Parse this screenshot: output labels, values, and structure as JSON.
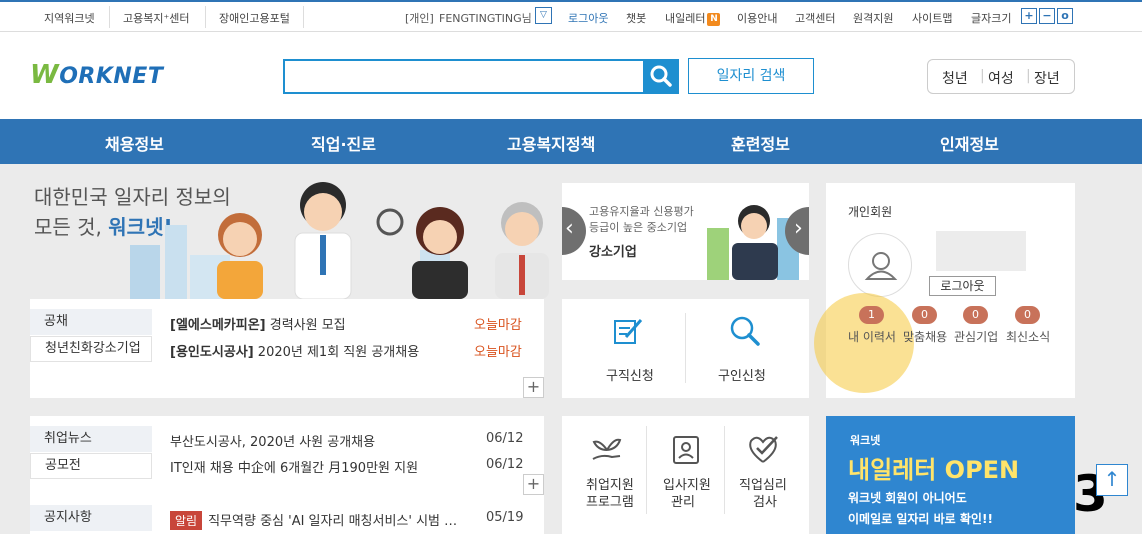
{
  "topbar": {
    "links": [
      "지역워크넷",
      "고용복지⁺센터",
      "장애인고용포털"
    ],
    "user_type": "[개인]",
    "user_name": "FENGTINGTING님",
    "dropdown": "▽",
    "logout": "로그아웃",
    "chatbot": "챗봇",
    "newsletter": "내일레터",
    "newsletter_badge": "N",
    "guide": "이용안내",
    "support": "고객센터",
    "remote": "원격지원",
    "sitemap": "사이트맵",
    "fontsize": "글자크기",
    "font_plus": "+",
    "font_minus": "−",
    "font_reset": "o"
  },
  "header": {
    "logo_w": "W",
    "logo_rest": "ORKNET",
    "search_placeholder": "",
    "job_search": "일자리 검색",
    "targets": [
      "청년",
      "여성",
      "장년"
    ]
  },
  "nav": [
    "채용정보",
    "직업·진로",
    "고용복지정책",
    "훈련정보",
    "인재정보"
  ],
  "hero": {
    "line1": "대한민국 일자리 정보의",
    "line2a": "모든 것, ",
    "line2b": "워크넷!"
  },
  "recruit": {
    "tabs": [
      "공채",
      "청년친화강소기업"
    ],
    "rows": [
      {
        "company": "[엘에스메카피온]",
        "title": "경력사원 모집",
        "due": "오늘마감"
      },
      {
        "company": "[용인도시공사]",
        "title": "2020년 제1회 직원 공개채용",
        "due": "오늘마감"
      }
    ],
    "more": "+"
  },
  "banner": {
    "line1": "고용유지율과 신용평가",
    "line2": "등급이 높은 중소기업",
    "line3": "강소기업",
    "prev": "‹",
    "next": "›"
  },
  "services": {
    "apply_job": "구직신청",
    "apply_hire": "구인신청"
  },
  "member": {
    "title": "개인회원",
    "logout": "로그아웃",
    "items": [
      {
        "label": "내 이력서",
        "count": "1"
      },
      {
        "label": "맞춤채용",
        "count": "0"
      },
      {
        "label": "관심기업",
        "count": "0"
      },
      {
        "label": "최신소식",
        "count": "0"
      }
    ]
  },
  "news": {
    "tabs": [
      "취업뉴스",
      "공모전"
    ],
    "rows": [
      {
        "title": "부산도시공사, 2020년 사원 공개채용",
        "date": "06/12"
      },
      {
        "title": "IT인재 채용 中企에 6개월간 月190만원 지원",
        "date": "06/12"
      }
    ],
    "more": "+",
    "notice_tab": "공지사항",
    "notice_badge": "알림",
    "notice_title": "직무역량 중심 'AI 일자리 매칭서비스' 시범 …",
    "notice_date": "05/19"
  },
  "programs": [
    {
      "line1": "취업지원",
      "line2": "프로그램"
    },
    {
      "line1": "입사지원",
      "line2": "관리"
    },
    {
      "line1": "직업심리",
      "line2": "검사"
    }
  ],
  "promo": {
    "brand": "워크넷",
    "headline": "내일레터 OPEN",
    "line1": "워크넷 회원이 아니어도",
    "line2": "이메일로 일자리 바로 확인!!"
  },
  "overlay": {
    "number": "3",
    "scroll_top": "↑"
  }
}
